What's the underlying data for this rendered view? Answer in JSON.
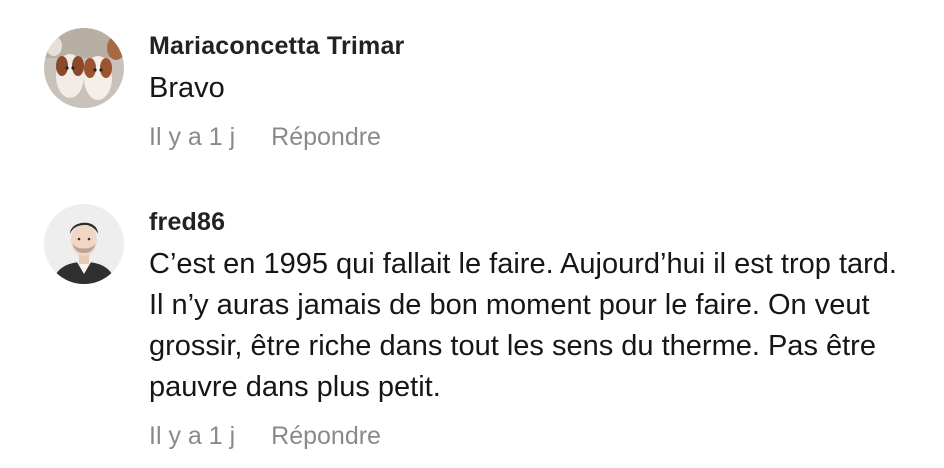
{
  "comments": [
    {
      "username": "Mariaconcetta Trimar",
      "text": "Bravo",
      "time": "Il y a 1 j",
      "reply_label": "Répondre",
      "avatar_icon": "puppies-photo-avatar"
    },
    {
      "username": "fred86",
      "text": "C’est en 1995 qui fallait le faire. Aujourd’hui il est trop tard. Il n’y auras jamais de bon moment pour le faire. On veut grossir, être riche dans tout les sens du therme. Pas être pauvre dans plus petit.",
      "time": "Il y a 1 j",
      "reply_label": "Répondre",
      "avatar_icon": "man-portrait-avatar"
    }
  ],
  "colors": {
    "username": "#222222",
    "text": "#161616",
    "meta": "#8a8a8a",
    "background": "#ffffff"
  }
}
